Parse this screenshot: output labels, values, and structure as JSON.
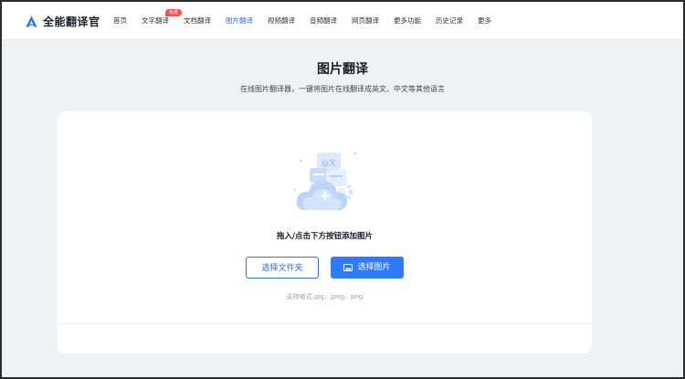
{
  "app": {
    "name": "全能翻译官",
    "accent": "#2f6bff"
  },
  "nav": {
    "items": [
      {
        "label": "首页"
      },
      {
        "label": "文字翻译",
        "badge": "免费"
      },
      {
        "label": "文档翻译"
      },
      {
        "label": "图片翻译",
        "active": true
      },
      {
        "label": "视频翻译"
      },
      {
        "label": "音频翻译"
      },
      {
        "label": "网页翻译"
      },
      {
        "label": "更多功能"
      },
      {
        "label": "历史记录"
      },
      {
        "label": "更多"
      }
    ]
  },
  "hero": {
    "title": "图片翻译",
    "subtitle": "在线图片翻译器，一键将图片在线翻译成英文、中文等其他语言"
  },
  "upload": {
    "illustration_icon": "cloud-upload-plus-icon",
    "drop_text": "拖入/点击下方按钮添加图片",
    "folder_button": "选择文件夹",
    "image_button": "选择图片",
    "formats": "支持格式:jpg、jpeg、png"
  }
}
